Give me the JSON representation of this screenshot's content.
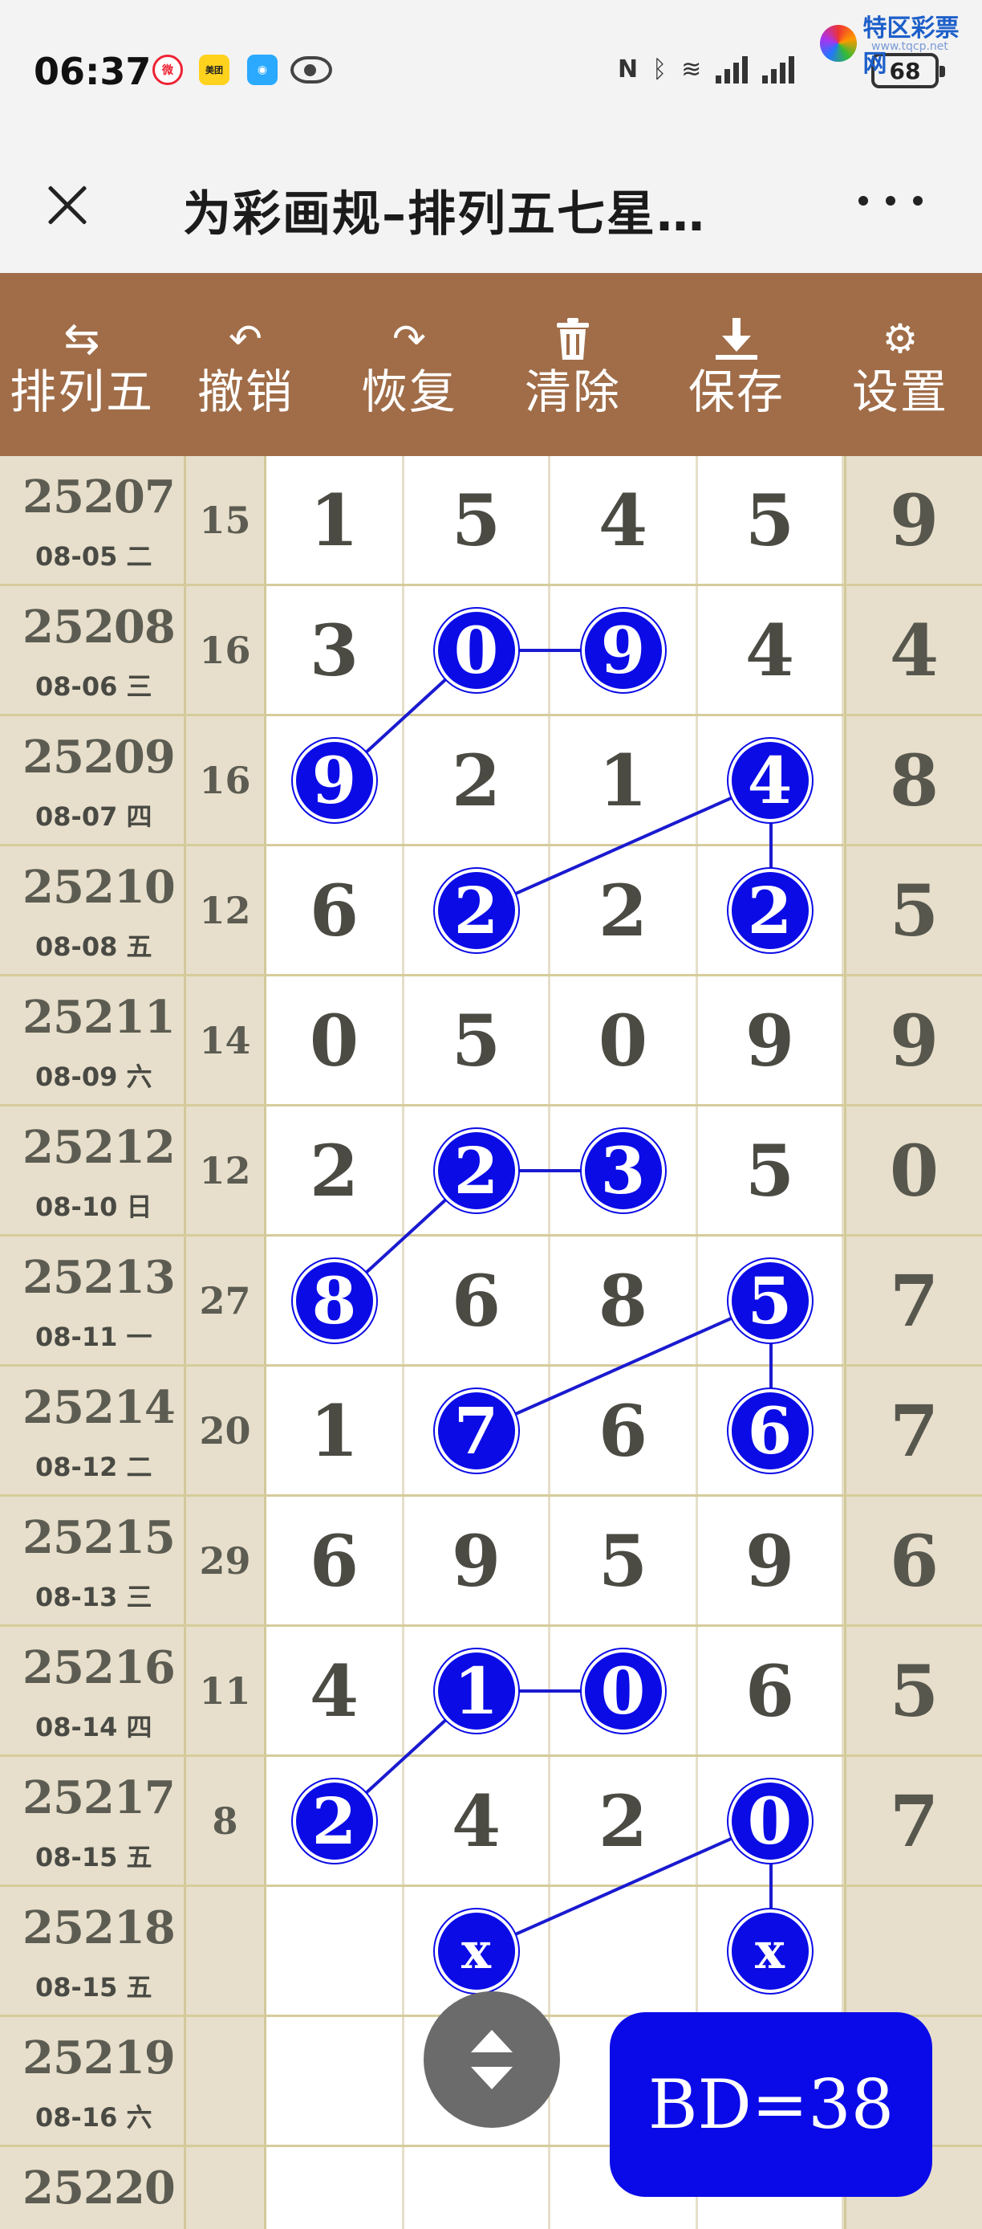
{
  "status_bar": {
    "time": "06:37",
    "apps": [
      "weibo",
      "美团",
      "chat"
    ],
    "battery": "68",
    "watermark_name": "特区彩票网",
    "watermark_url": "www.tqcp.net"
  },
  "header": {
    "title": "为彩画规–排列五七星…"
  },
  "toolbar": [
    {
      "icon": "swap-icon",
      "label": "排列五"
    },
    {
      "icon": "undo-icon",
      "label": "撤销"
    },
    {
      "icon": "redo-icon",
      "label": "恢复"
    },
    {
      "icon": "trash-icon",
      "label": "清除"
    },
    {
      "icon": "download-icon",
      "label": "保存"
    },
    {
      "icon": "gear-icon",
      "label": "设置"
    }
  ],
  "rows": [
    {
      "issue": "25207",
      "date": "08-05 二",
      "sum": "15",
      "digits": [
        "1",
        "5",
        "4",
        "5"
      ],
      "last": "9",
      "marked": []
    },
    {
      "issue": "25208",
      "date": "08-06 三",
      "sum": "16",
      "digits": [
        "3",
        "0",
        "9",
        "4"
      ],
      "last": "4",
      "marked": [
        1,
        2
      ]
    },
    {
      "issue": "25209",
      "date": "08-07 四",
      "sum": "16",
      "digits": [
        "9",
        "2",
        "1",
        "4"
      ],
      "last": "8",
      "marked": [
        0,
        3
      ]
    },
    {
      "issue": "25210",
      "date": "08-08 五",
      "sum": "12",
      "digits": [
        "6",
        "2",
        "2",
        "2"
      ],
      "last": "5",
      "marked": [
        1,
        3
      ]
    },
    {
      "issue": "25211",
      "date": "08-09 六",
      "sum": "14",
      "digits": [
        "0",
        "5",
        "0",
        "9"
      ],
      "last": "9",
      "marked": []
    },
    {
      "issue": "25212",
      "date": "08-10 日",
      "sum": "12",
      "digits": [
        "2",
        "2",
        "3",
        "5"
      ],
      "last": "0",
      "marked": [
        1,
        2
      ]
    },
    {
      "issue": "25213",
      "date": "08-11 一",
      "sum": "27",
      "digits": [
        "8",
        "6",
        "8",
        "5"
      ],
      "last": "7",
      "marked": [
        0,
        3
      ]
    },
    {
      "issue": "25214",
      "date": "08-12 二",
      "sum": "20",
      "digits": [
        "1",
        "7",
        "6",
        "6"
      ],
      "last": "7",
      "marked": [
        1,
        3
      ]
    },
    {
      "issue": "25215",
      "date": "08-13 三",
      "sum": "29",
      "digits": [
        "6",
        "9",
        "5",
        "9"
      ],
      "last": "6",
      "marked": []
    },
    {
      "issue": "25216",
      "date": "08-14 四",
      "sum": "11",
      "digits": [
        "4",
        "1",
        "0",
        "6"
      ],
      "last": "5",
      "marked": [
        1,
        2
      ]
    },
    {
      "issue": "25217",
      "date": "08-15 五",
      "sum": "8",
      "digits": [
        "2",
        "4",
        "2",
        "0"
      ],
      "last": "7",
      "marked": [
        0,
        3
      ]
    },
    {
      "issue": "25218",
      "date": "08-15 五",
      "sum": "",
      "digits": [
        "",
        "x",
        "",
        "x"
      ],
      "last": "",
      "marked": [
        1,
        3
      ]
    },
    {
      "issue": "25219",
      "date": "08-16 六",
      "sum": "",
      "digits": [
        "",
        "",
        "",
        ""
      ],
      "last": "",
      "marked": []
    },
    {
      "issue": "25220",
      "date": "",
      "sum": "",
      "digits": [
        "",
        "",
        "",
        ""
      ],
      "last": "",
      "marked": []
    }
  ],
  "connections": [
    [
      [
        2,
        0
      ],
      [
        1,
        1
      ]
    ],
    [
      [
        1,
        1
      ],
      [
        1,
        2
      ]
    ],
    [
      [
        3,
        1
      ],
      [
        2,
        3
      ]
    ],
    [
      [
        2,
        3
      ],
      [
        3,
        3
      ]
    ],
    [
      [
        6,
        0
      ],
      [
        5,
        1
      ]
    ],
    [
      [
        5,
        1
      ],
      [
        5,
        2
      ]
    ],
    [
      [
        7,
        1
      ],
      [
        6,
        3
      ]
    ],
    [
      [
        6,
        3
      ],
      [
        7,
        3
      ]
    ],
    [
      [
        10,
        0
      ],
      [
        9,
        1
      ]
    ],
    [
      [
        9,
        1
      ],
      [
        9,
        2
      ]
    ],
    [
      [
        11,
        1
      ],
      [
        10,
        3
      ]
    ],
    [
      [
        10,
        3
      ],
      [
        11,
        3
      ]
    ]
  ],
  "bd_label": "BD=38",
  "colors": {
    "toolbar_bg": "#a06d48",
    "ball": "#0b0be6",
    "line": "#1a1ad0",
    "bd_bg": "#0a0ae8"
  }
}
